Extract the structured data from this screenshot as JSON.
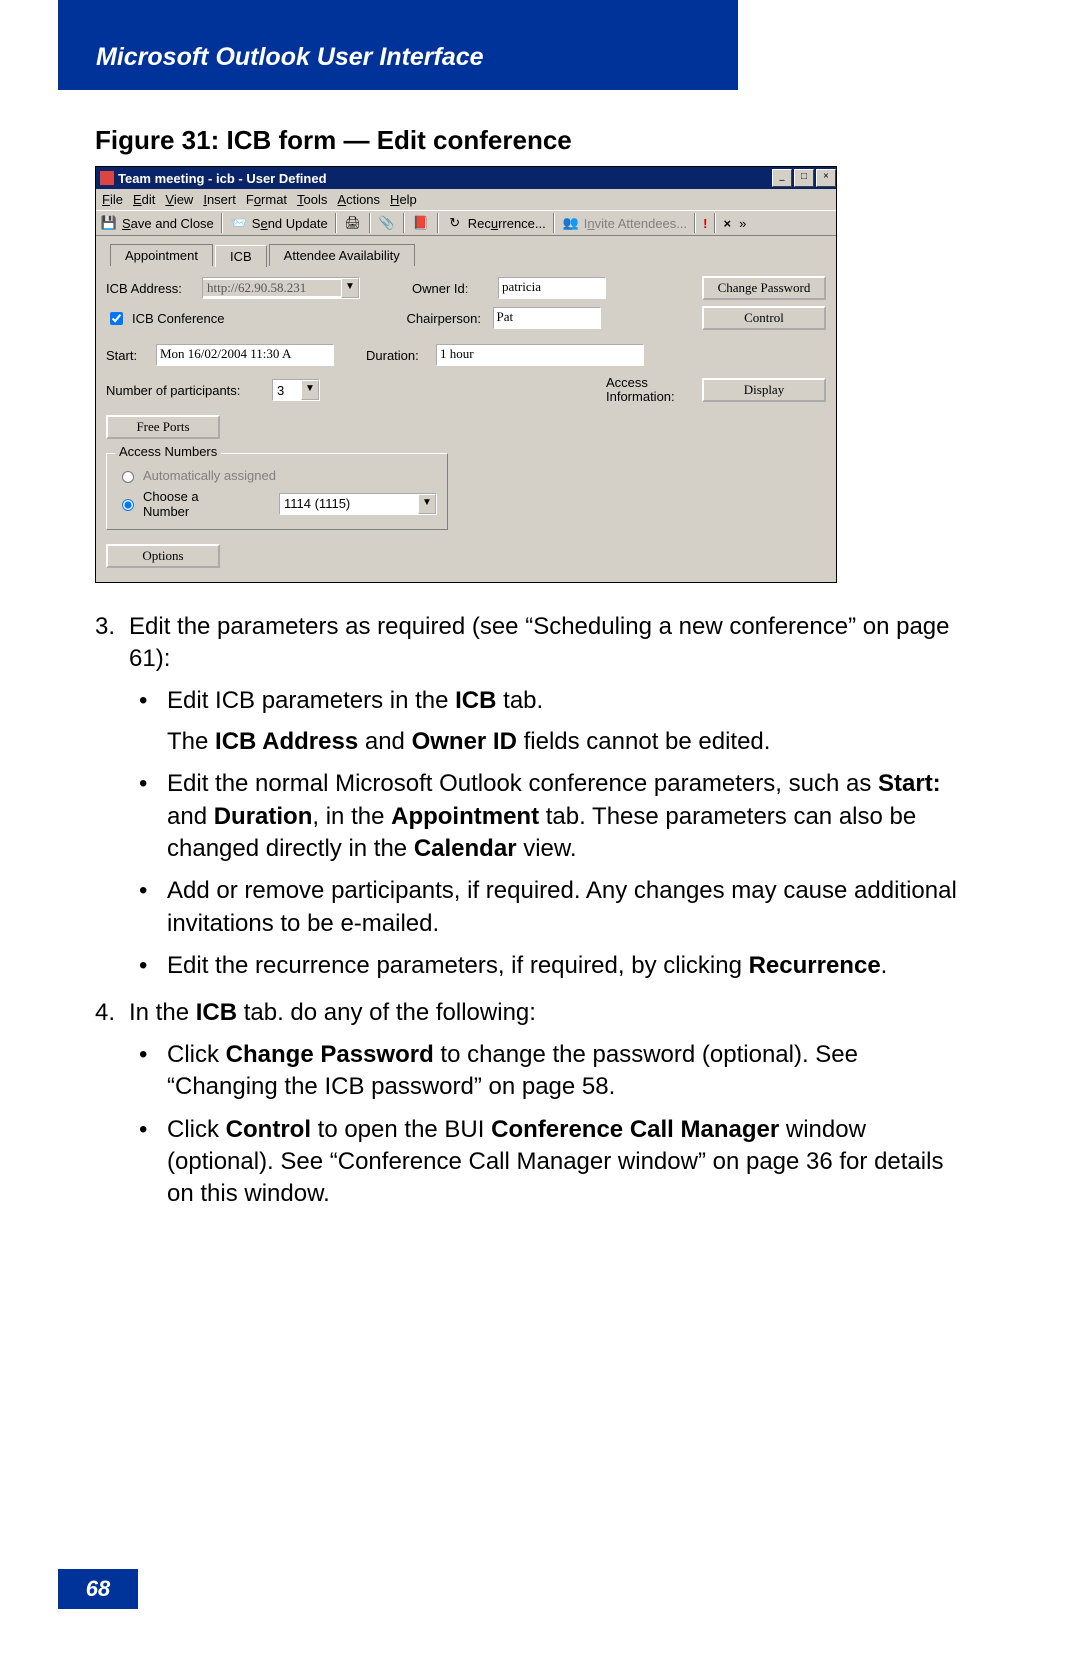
{
  "header": {
    "title": "Microsoft Outlook User Interface"
  },
  "figure": {
    "caption": "Figure 31: ICB form — Edit conference"
  },
  "window": {
    "title": "Team meeting - icb   - User Defined",
    "min_label": "_",
    "max_label": "□",
    "close_label": "×"
  },
  "menubar": {
    "file": "File",
    "edit": "Edit",
    "view": "View",
    "insert": "Insert",
    "format": "Format",
    "tools": "Tools",
    "actions": "Actions",
    "help": "Help"
  },
  "toolbar": {
    "save_close": "Save and Close",
    "send_update": "Send Update",
    "recurrence": "Recurrence...",
    "invite_attendees": "Invite Attendees...",
    "bang": "!",
    "close": "×",
    "more": "»"
  },
  "tabs": {
    "appointment": "Appointment",
    "icb": "ICB",
    "attendee": "Attendee Availability"
  },
  "form": {
    "icb_address_label": "ICB Address:",
    "icb_address_value": "http://62.90.58.231",
    "icb_conference_label": "ICB Conference",
    "owner_id_label": "Owner Id:",
    "owner_id_value": "patricia",
    "chairperson_label": "Chairperson:",
    "chairperson_value": "Pat",
    "change_password": "Change Password",
    "control": "Control",
    "start_label": "Start:",
    "start_value": "Mon 16/02/2004 11:30 A",
    "duration_label": "Duration:",
    "duration_value": "1 hour",
    "num_participants_label": "Number of participants:",
    "num_participants_value": "3",
    "access_info_label": "Access Information:",
    "display": "Display",
    "free_ports": "Free Ports",
    "access_numbers_legend": "Access Numbers",
    "auto_assigned_label": "Automatically assigned",
    "choose_number_label": "Choose a Number",
    "choose_number_value": "1114 (1115)",
    "options": "Options"
  },
  "doc": {
    "step3_num": "3.",
    "step3_text_a": "Edit the parameters as required (see “Scheduling a new conference” on page 61):",
    "b1_a": "Edit ICB parameters in the ",
    "b1_b": "ICB",
    "b1_c": " tab.",
    "b1_sub_a": "The ",
    "b1_sub_b": "ICB Address",
    "b1_sub_c": " and ",
    "b1_sub_d": "Owner ID",
    "b1_sub_e": " fields cannot be edited.",
    "b2_a": "Edit the normal Microsoft Outlook conference parameters, such as ",
    "b2_b": "Start:",
    "b2_c": " and ",
    "b2_d": "Duration",
    "b2_e": ", in the ",
    "b2_f": "Appointment",
    "b2_g": " tab. These parameters can also be changed directly in the ",
    "b2_h": "Calendar",
    "b2_i": " view.",
    "b3": "Add or remove participants, if required. Any changes may cause additional invitations to be e-mailed.",
    "b4_a": "Edit the recurrence parameters, if required, by clicking ",
    "b4_b": "Recurrence",
    "b4_c": ".",
    "step4_num": "4.",
    "step4_a": "In the ",
    "step4_b": "ICB",
    "step4_c": " tab. do any of the following:",
    "b5_a": "Click ",
    "b5_b": "Change Password",
    "b5_c": " to change the password (optional). See “Changing the ICB password” on page 58.",
    "b6_a": "Click ",
    "b6_b": "Control",
    "b6_c": " to open the BUI ",
    "b6_d": "Conference Call Manager",
    "b6_e": " window (optional). See “Conference Call Manager window” on page 36 for details on this window."
  },
  "footer": {
    "page": "68"
  }
}
